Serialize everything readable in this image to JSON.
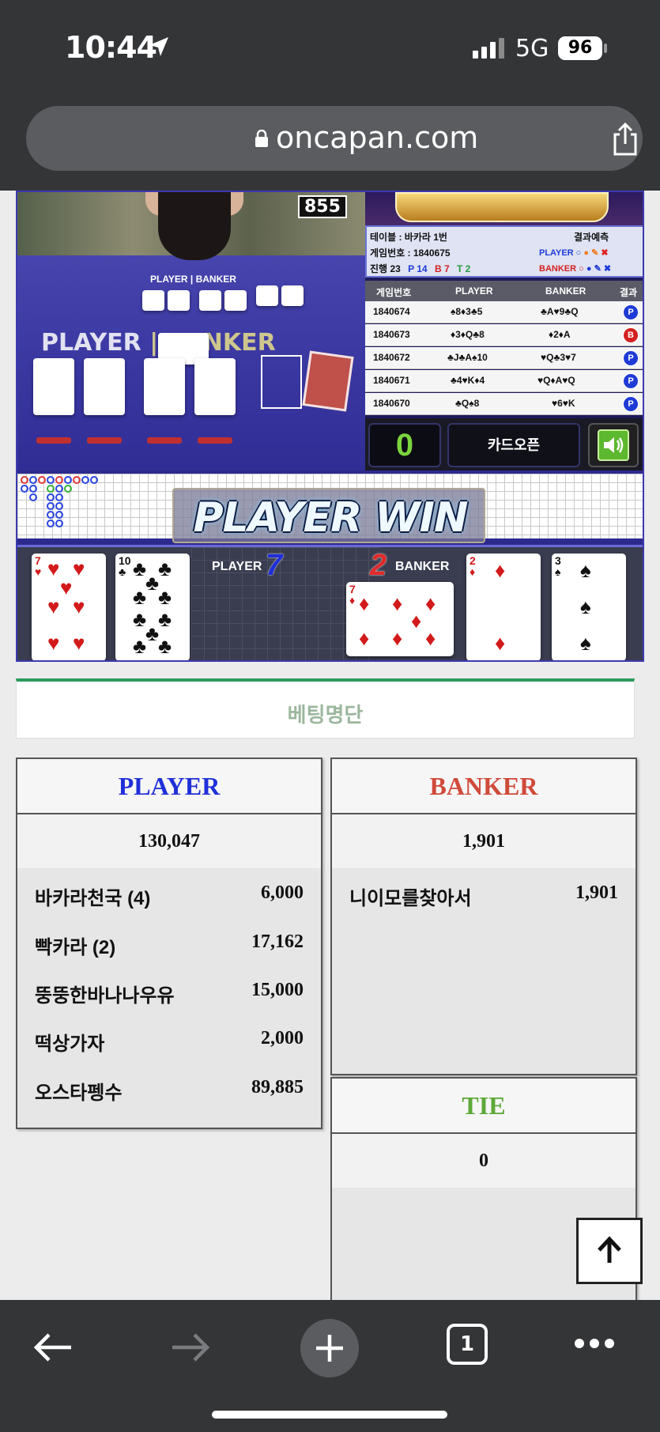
{
  "status_bar": {
    "time": "10:44",
    "network": "5G",
    "battery": "96"
  },
  "browser": {
    "url": "oncapan.com",
    "tab_count": "1"
  },
  "video": {
    "counter": "855",
    "table_player_label": "PLAYER",
    "table_banker_label": "BANKER",
    "mini_label": "PLAYER | BANKER"
  },
  "info": {
    "table_line": "테이블 : 바카라 1번",
    "game_no_line": "게임번호 : 1840675",
    "progress_label": "진행",
    "progress_total": "23",
    "p_count": "P 14",
    "b_count": "B 7",
    "t_count": "T 2",
    "predict_label": "결과예측",
    "predict_player": "PLAYER",
    "predict_banker": "BANKER"
  },
  "history": {
    "headers": [
      "게임번호",
      "PLAYER",
      "BANKER",
      "결과"
    ],
    "rows": [
      {
        "id": "1840674",
        "player": "♠8♦3♣5",
        "banker": "♣A♥9♣Q",
        "result": "P"
      },
      {
        "id": "1840673",
        "player": "♦3♦Q♣8",
        "banker": "♦2♦A",
        "result": "B"
      },
      {
        "id": "1840672",
        "player": "♣J♣A♠10",
        "banker": "♥Q♣3♥7",
        "result": "P"
      },
      {
        "id": "1840671",
        "player": "♣4♥K♦4",
        "banker": "♥Q♦A♥Q",
        "result": "P"
      },
      {
        "id": "1840670",
        "player": "♣Q♠8",
        "banker": "♥6♥K",
        "result": "P"
      }
    ]
  },
  "controls": {
    "count": "0",
    "card_open": "카드오픈"
  },
  "result": {
    "win_text": "PLAYER WIN",
    "player_label": "PLAYER",
    "player_score": "7",
    "banker_label": "BANKER",
    "banker_score": "2",
    "player_cards": [
      {
        "rank": "7",
        "suit": "♥"
      },
      {
        "rank": "10",
        "suit": "♣"
      }
    ],
    "banker_cards": [
      {
        "rank": "7",
        "suit": "♦"
      },
      {
        "rank": "2",
        "suit": "♦"
      },
      {
        "rank": "3",
        "suit": "♠"
      }
    ]
  },
  "betting": {
    "title": "베팅명단",
    "player": {
      "label": "PLAYER",
      "total": "130,047",
      "bets": [
        {
          "name": "바카라천국 (4)",
          "amount": "6,000"
        },
        {
          "name": "빡카라 (2)",
          "amount": "17,162"
        },
        {
          "name": "뚱뚱한바나나우유",
          "amount": "15,000"
        },
        {
          "name": "떡상가자",
          "amount": "2,000"
        },
        {
          "name": "오스타펭수",
          "amount": "89,885"
        }
      ]
    },
    "banker": {
      "label": "BANKER",
      "total": "1,901",
      "bets": [
        {
          "name": "니이모를찾아서",
          "amount": "1,901"
        }
      ]
    },
    "tie": {
      "label": "TIE",
      "total": "0"
    }
  },
  "colors": {
    "player": "#2030d8",
    "banker": "#d04a3a",
    "tie": "#5ea838",
    "accent_green": "#2a9a5e"
  },
  "icons": {
    "location": "location-arrow-icon",
    "lock": "lock-icon",
    "share": "share-icon",
    "back": "back-arrow-icon",
    "forward": "forward-arrow-icon",
    "new_tab": "plus-icon",
    "more": "more-icon",
    "scroll_top": "arrow-up-icon",
    "sound": "speaker-icon"
  }
}
